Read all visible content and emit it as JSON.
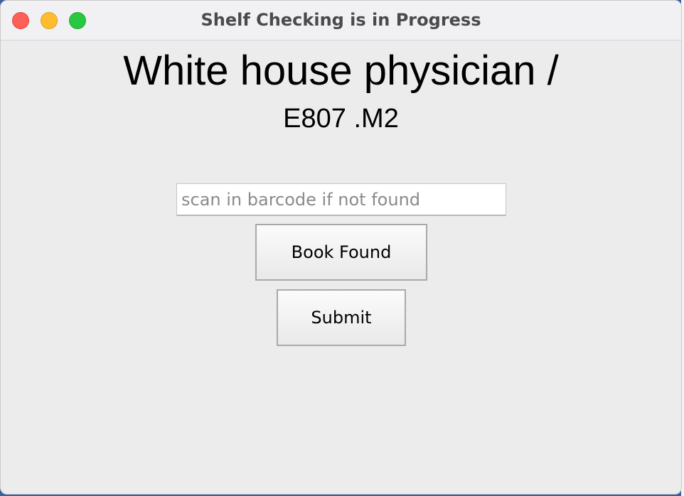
{
  "window": {
    "title": "Shelf Checking is in Progress"
  },
  "book": {
    "title": "White house physician /",
    "call_number": "E807 .M2"
  },
  "barcode_input": {
    "placeholder": "scan in barcode if not found",
    "value": ""
  },
  "buttons": {
    "book_found": "Book Found",
    "submit": "Submit"
  },
  "colors": {
    "close": "#fe5f57",
    "minimize": "#febc2e",
    "zoom": "#28c840",
    "window_background": "#ececec"
  }
}
